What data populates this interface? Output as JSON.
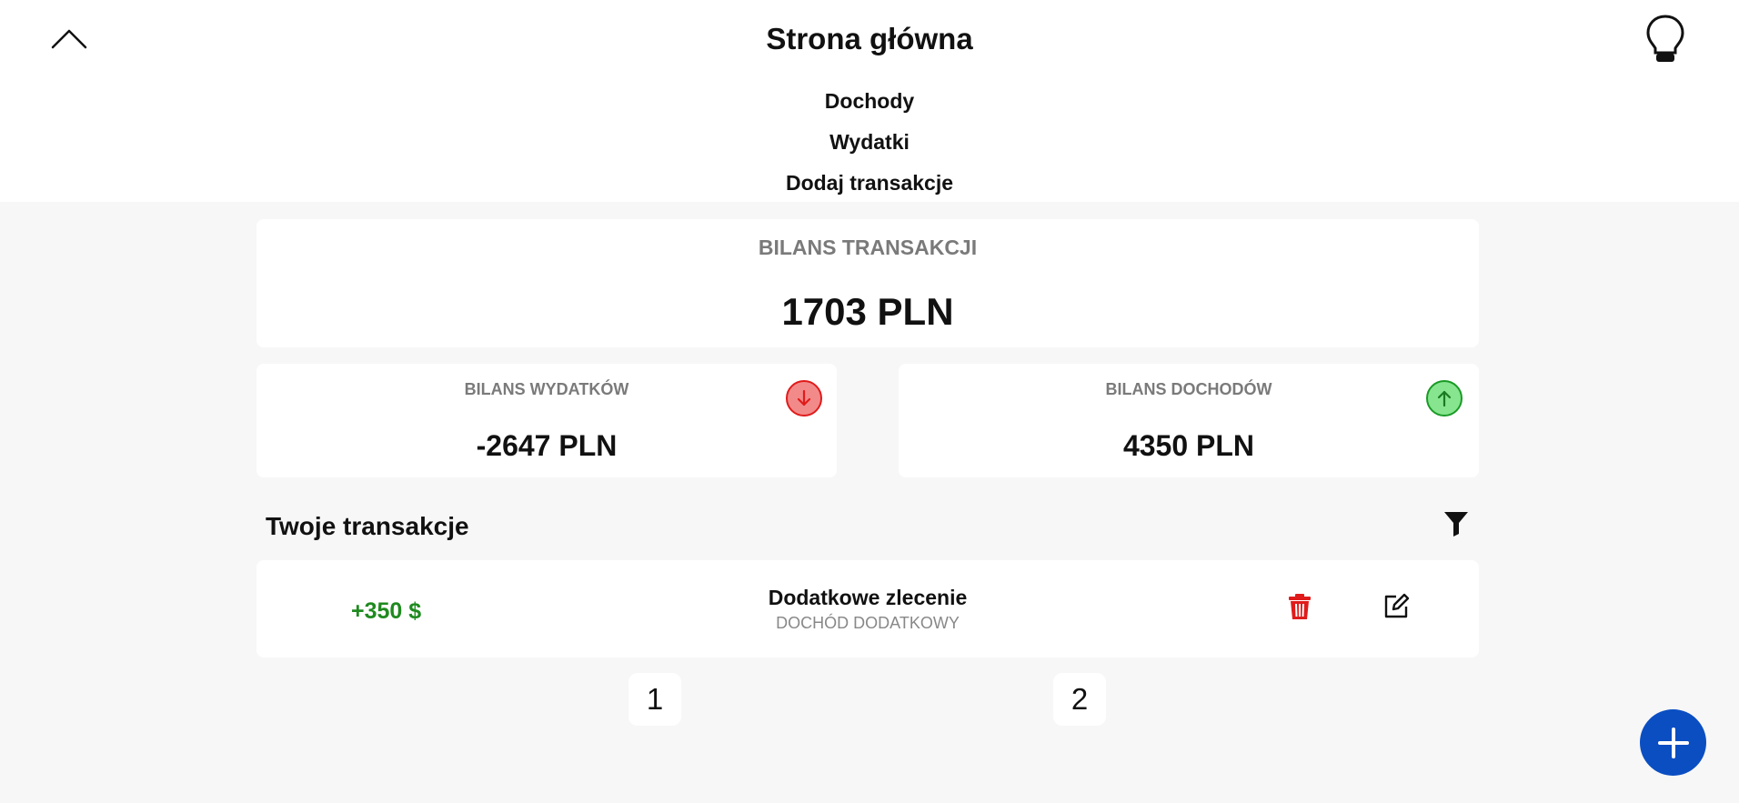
{
  "header": {
    "title": "Strona główna",
    "nav": [
      "Dochody",
      "Wydatki",
      "Dodaj transakcje"
    ]
  },
  "balance": {
    "label": "BILANS TRANSAKCJI",
    "value": "1703 PLN"
  },
  "expenses": {
    "label": "BILANS WYDATKÓW",
    "value": "-2647 PLN",
    "icon": "arrow-down-icon",
    "color": "#e01b1b"
  },
  "income": {
    "label": "BILANS DOCHODÓW",
    "value": "4350 PLN",
    "icon": "arrow-up-icon",
    "color": "#1a9a26"
  },
  "transactions": {
    "title": "Twoje transakcje",
    "items": [
      {
        "amount": "+350 $",
        "title": "Dodatkowe zlecenie",
        "category": "DOCHÓD DODATKOWY",
        "amount_color": "#1f8a1f"
      }
    ]
  },
  "pagination": [
    "1",
    "2"
  ],
  "colors": {
    "accent": "#0a4ec2",
    "delete": "#e01b1b"
  }
}
